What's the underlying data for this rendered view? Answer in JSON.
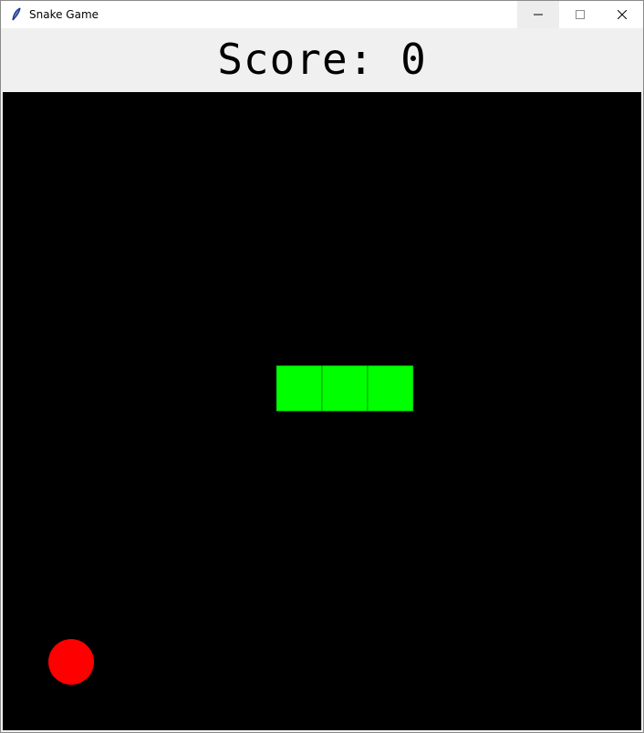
{
  "window": {
    "title": "Snake Game",
    "app_icon": "feather-icon",
    "controls": [
      "minimize-icon",
      "maximize-icon",
      "close-icon"
    ]
  },
  "score": {
    "text": "Score: 0",
    "value": 0
  },
  "board": {
    "background": "#000000",
    "grid_size": 14,
    "snake": {
      "color": "#00ff00",
      "segments": [
        {
          "col": 6,
          "row": 6
        },
        {
          "col": 7,
          "row": 6
        },
        {
          "col": 8,
          "row": 6
        }
      ]
    },
    "food": {
      "color": "#ff0000",
      "col": 1,
      "row": 12
    }
  }
}
